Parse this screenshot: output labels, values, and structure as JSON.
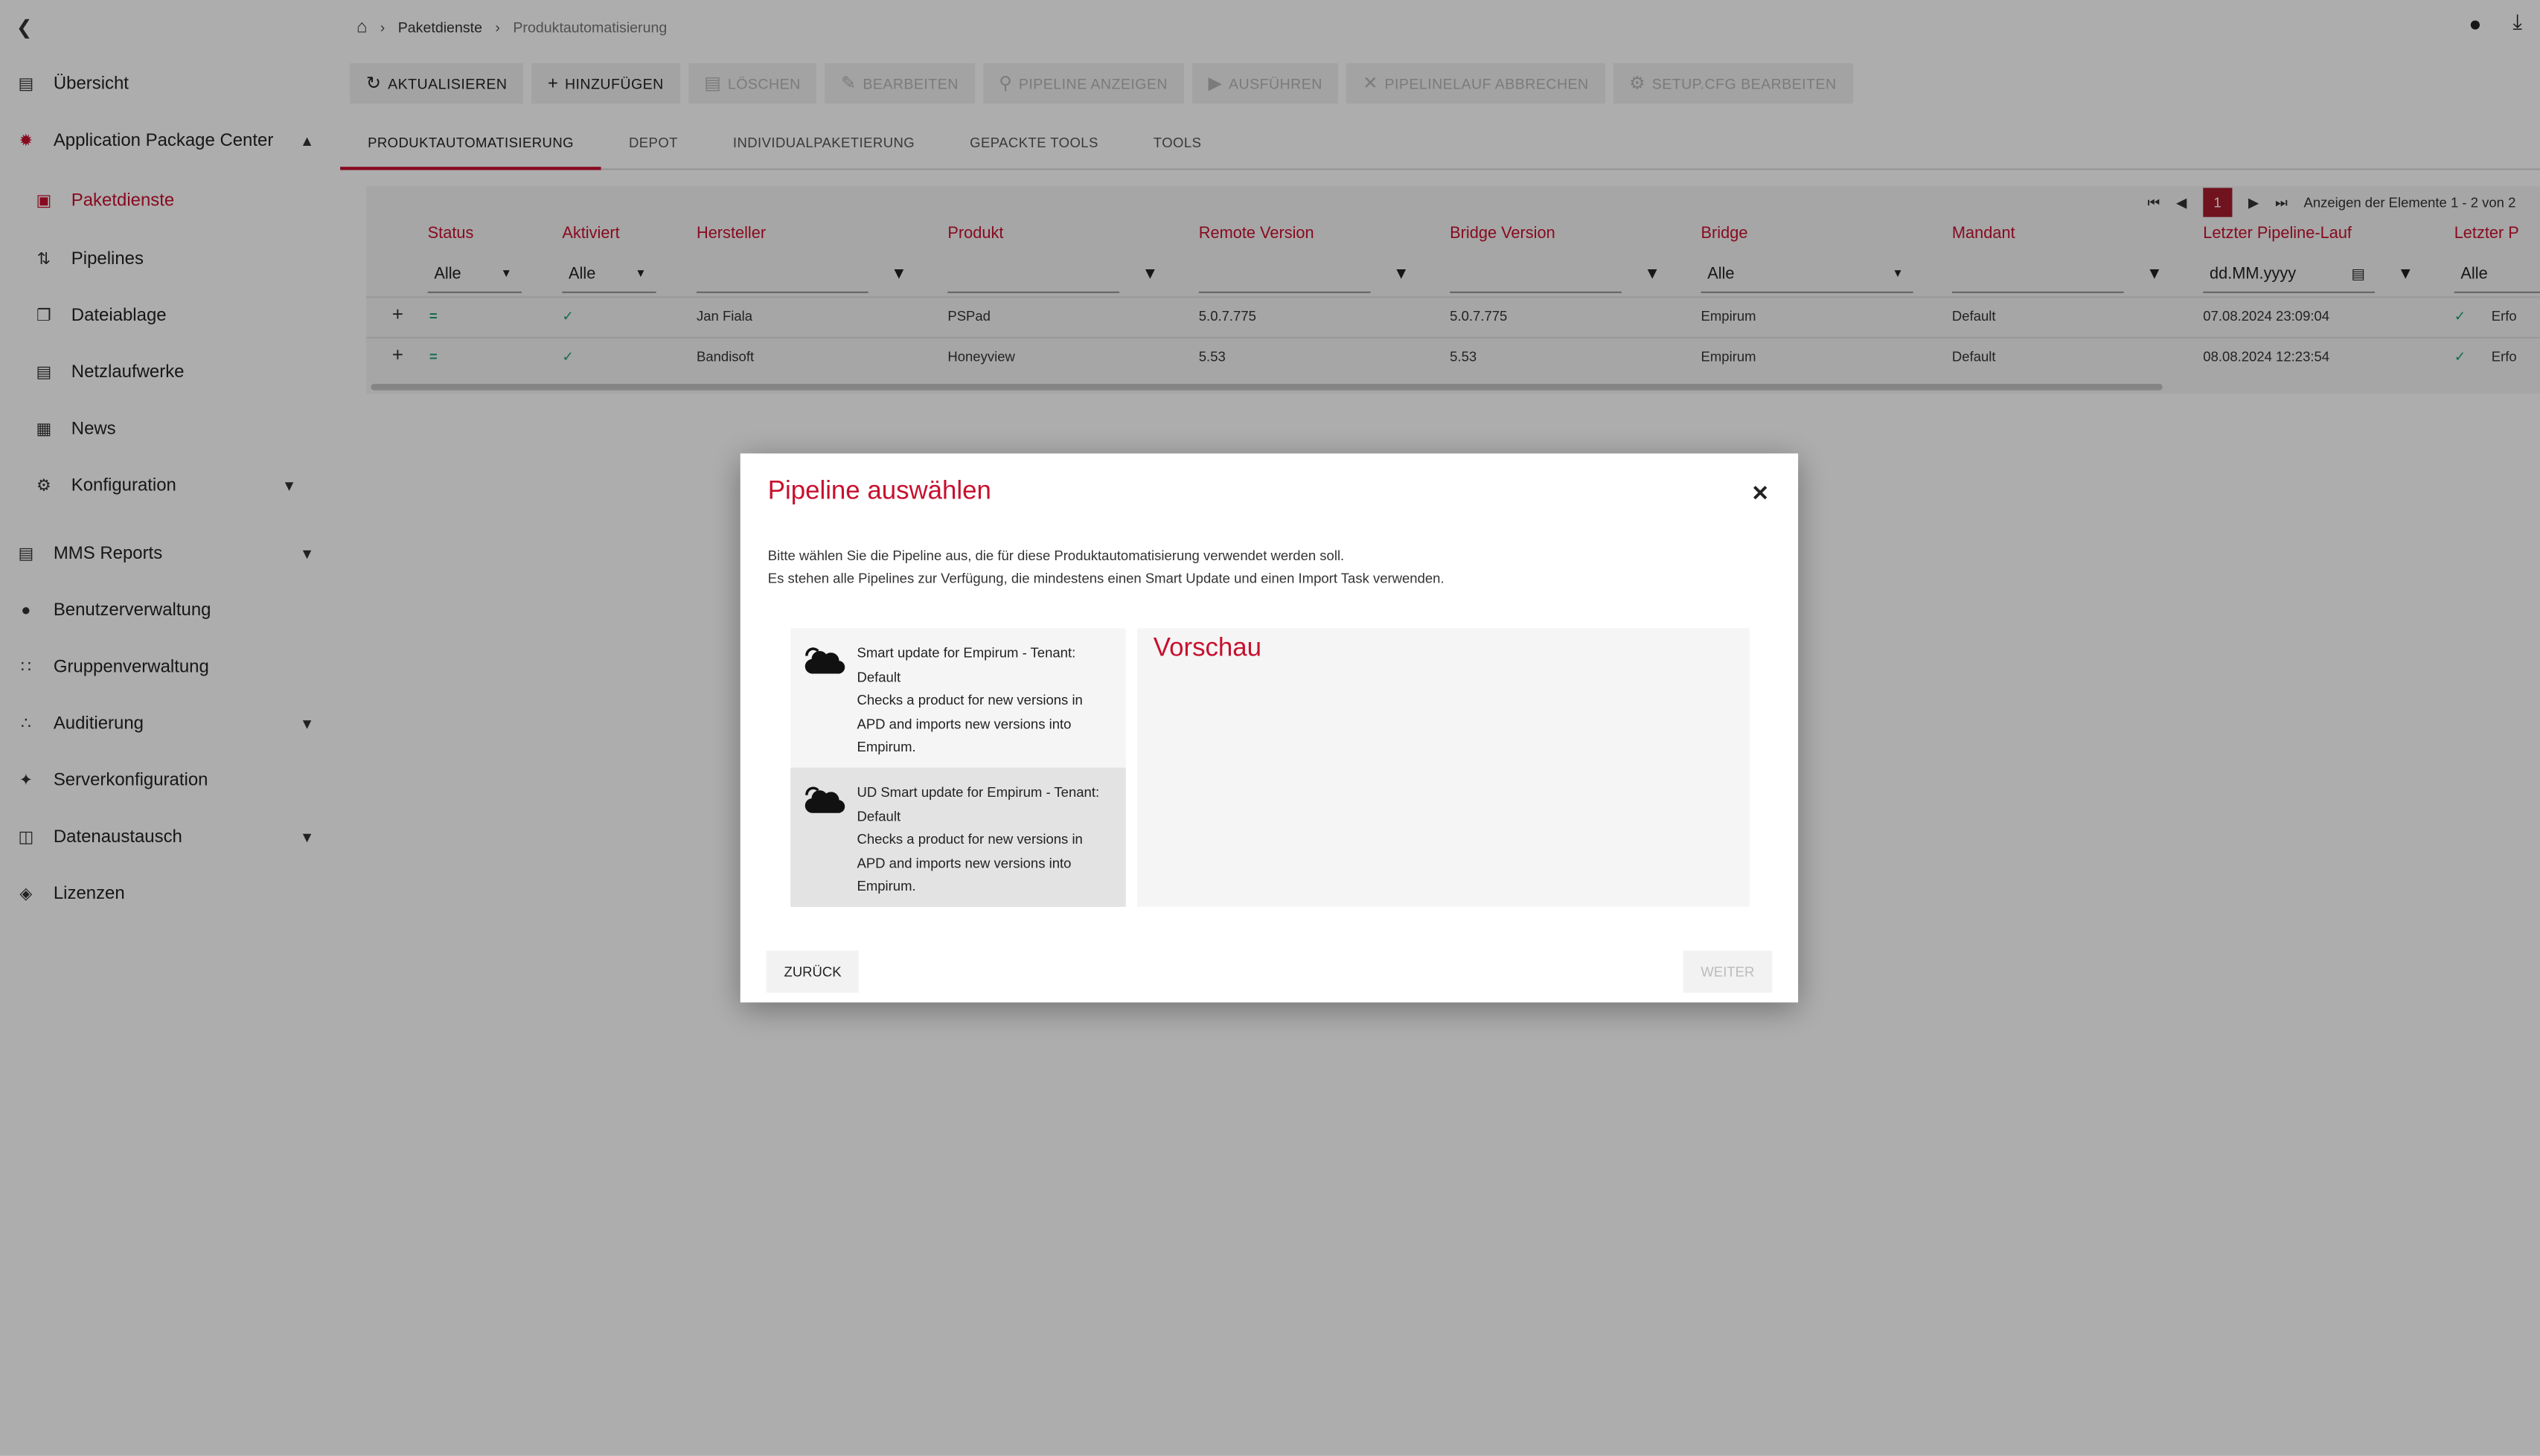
{
  "sidebar": {
    "items": [
      {
        "label": "Übersicht",
        "icon": "chart-icon"
      },
      {
        "label": "Application Package Center",
        "icon": "apc-gear-icon"
      },
      {
        "label": "Paketdienste",
        "icon": "package-service-icon"
      },
      {
        "label": "Pipelines",
        "icon": "pipeline-icon"
      },
      {
        "label": "Dateiablage",
        "icon": "file-storage-icon"
      },
      {
        "label": "Netzlaufwerke",
        "icon": "network-drive-icon"
      },
      {
        "label": "News",
        "icon": "news-icon"
      },
      {
        "label": "Konfiguration",
        "icon": "gear-icon"
      },
      {
        "label": "MMS Reports",
        "icon": "report-icon"
      },
      {
        "label": "Benutzerverwaltung",
        "icon": "user-icon"
      },
      {
        "label": "Gruppenverwaltung",
        "icon": "group-icon"
      },
      {
        "label": "Auditierung",
        "icon": "audit-icon"
      },
      {
        "label": "Serverkonfiguration",
        "icon": "server-config-icon"
      },
      {
        "label": "Datenaustausch",
        "icon": "database-icon"
      },
      {
        "label": "Lizenzen",
        "icon": "license-icon"
      }
    ]
  },
  "breadcrumb": {
    "level1": "Paketdienste",
    "level2": "Produktautomatisierung"
  },
  "toolbar": {
    "refresh": "AKTUALISIEREN",
    "add": "HINZUFÜGEN",
    "delete": "LÖSCHEN",
    "edit": "BEARBEITEN",
    "show_pipeline": "PIPELINE ANZEIGEN",
    "run": "AUSFÜHREN",
    "abort": "PIPELINELAUF ABBRECHEN",
    "setup_cfg": "SETUP.CFG BEARBEITEN"
  },
  "tabs": [
    "PRODUKTAUTOMATISIERUNG",
    "DEPOT",
    "INDIVIDUALPAKETIERUNG",
    "GEPACKTE TOOLS",
    "TOOLS"
  ],
  "pager": {
    "page": "1",
    "info": "Anzeigen der Elemente 1 - 2 von 2"
  },
  "table": {
    "columns": [
      "Status",
      "Aktiviert",
      "Hersteller",
      "Produkt",
      "Remote Version",
      "Bridge Version",
      "Bridge",
      "Mandant",
      "Letzter Pipeline-Lauf",
      "Letzter P"
    ],
    "filters": {
      "status": "Alle",
      "aktiviert": "Alle",
      "bridge": "Alle",
      "date_placeholder": "dd.MM.yyyy",
      "last": "Alle"
    },
    "rows": [
      {
        "hersteller": "Jan Fiala",
        "produkt": "PSPad",
        "remote": "5.0.7.775",
        "bridge_version": "5.0.7.775",
        "bridge": "Empirum",
        "mandant": "Default",
        "last_run": "07.08.2024 23:09:04",
        "last_status": "Erfo"
      },
      {
        "hersteller": "Bandisoft",
        "produkt": "Honeyview",
        "remote": "5.53",
        "bridge_version": "5.53",
        "bridge": "Empirum",
        "mandant": "Default",
        "last_run": "08.08.2024 12:23:54",
        "last_status": "Erfo"
      }
    ]
  },
  "dialog": {
    "title": "Pipeline auswählen",
    "text1": "Bitte wählen Sie die Pipeline aus, die für diese Produktautomatisierung verwendet werden soll.",
    "text2": "Es stehen alle Pipelines zur Verfügung, die mindestens einen Smart Update und einen Import Task verwenden.",
    "pipelines": [
      {
        "name": "Smart update for Empirum - Tenant: Default",
        "desc": "Checks a product for new versions in APD and imports new versions into Empirum."
      },
      {
        "name": "UD Smart update for Empirum - Tenant: Default",
        "desc": "Checks a product for new versions in APD and imports new versions into Empirum."
      }
    ],
    "preview_title": "Vorschau",
    "back": "ZURÜCK",
    "next": "WEITER"
  },
  "colors": {
    "accent": "#c8102e",
    "pager_active": "#a51d2d",
    "check": "#1a9e7a"
  }
}
